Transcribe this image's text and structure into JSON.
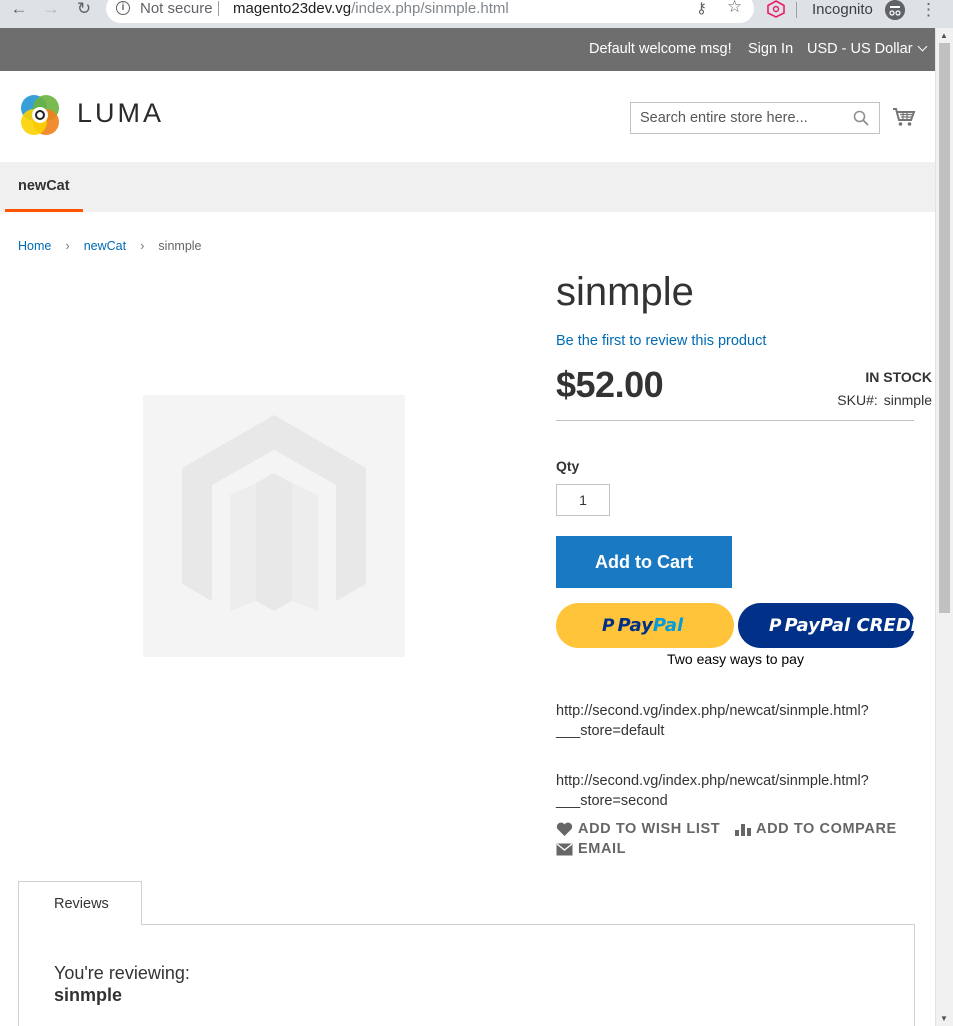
{
  "browser": {
    "security_label": "Not secure",
    "url_host": "magento23dev.vg",
    "url_path": "/index.php/sinmple.html",
    "incognito_label": "Incognito"
  },
  "top_panel": {
    "welcome": "Default welcome msg!",
    "sign_in": "Sign In",
    "currency": "USD - US Dollar"
  },
  "header": {
    "logo_text": "LUMA",
    "search_placeholder": "Search entire store here...",
    "colors": {
      "brand_orange": "#ff5501",
      "link_blue": "#006bb4",
      "button_blue": "#1979c3"
    }
  },
  "nav": {
    "items": [
      {
        "label": "newCat",
        "active": true
      }
    ]
  },
  "breadcrumbs": {
    "items": [
      "Home",
      "newCat"
    ],
    "current": "sinmple"
  },
  "product": {
    "name": "sinmple",
    "review_link": "Be the first to review this product",
    "price": "$52.00",
    "stock": "IN STOCK",
    "sku_label": "SKU#:",
    "sku_value": "sinmple",
    "qty_label": "Qty",
    "qty_value": "1",
    "add_to_cart": "Add to Cart",
    "paypal": {
      "label_a": "Pay",
      "label_b": "Pal",
      "credit_label": "PayPal CREDIT",
      "tagline": "Two easy ways to pay"
    },
    "store_urls": [
      {
        "line1": "http://second.vg/index.php/newcat/sinmple.html?",
        "line2": "___store=default"
      },
      {
        "line1": "http://second.vg/index.php/newcat/sinmple.html?",
        "line2": "___store=second"
      }
    ],
    "actions": {
      "wishlist": "ADD TO WISH LIST",
      "compare": "ADD TO COMPARE",
      "email": "EMAIL"
    }
  },
  "tabs": {
    "reviews_label": "Reviews",
    "reviewing_label": "You're reviewing:",
    "reviewing_name": "sinmple"
  }
}
